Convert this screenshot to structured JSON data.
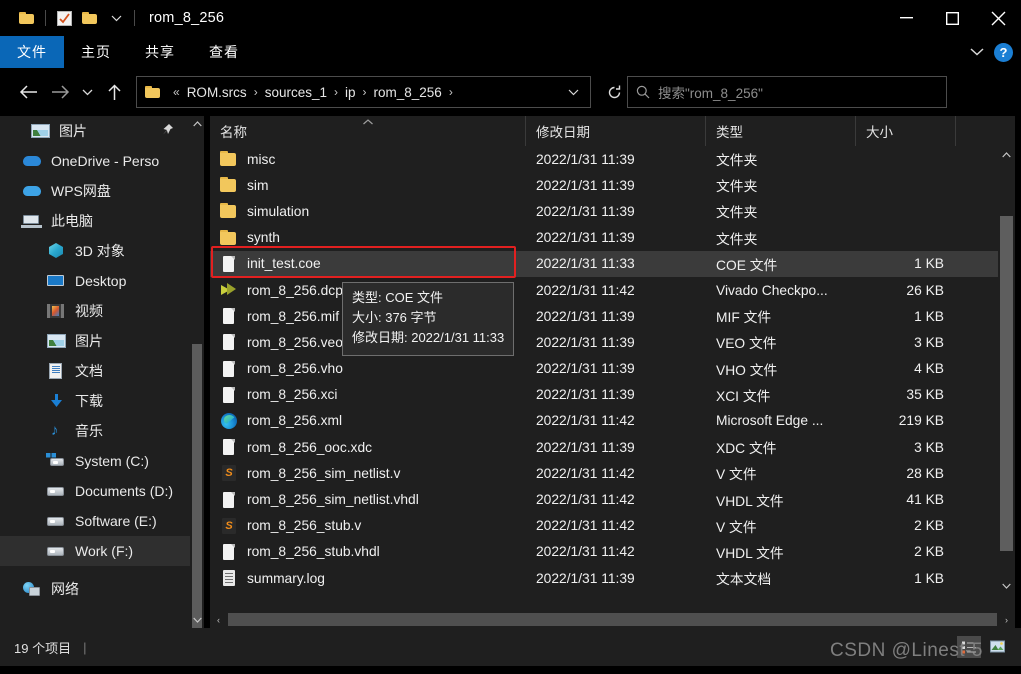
{
  "window": {
    "title": "rom_8_256",
    "quick_access": [
      "folder-icon",
      "checkbox-icon",
      "folder-icon",
      "dropdown-caret"
    ],
    "controls": {
      "minimize": "minimize-icon",
      "maximize": "maximize-icon",
      "close": "close-icon"
    }
  },
  "ribbon": {
    "tabs": [
      {
        "label": "文件",
        "active": true
      },
      {
        "label": "主页",
        "active": false
      },
      {
        "label": "共享",
        "active": false
      },
      {
        "label": "查看",
        "active": false
      }
    ],
    "collapse": "chevron-down-icon",
    "help": "?"
  },
  "address": {
    "back": "back-arrow-icon",
    "forward": "forward-arrow-icon",
    "recent": "chevron-down-icon",
    "up": "up-arrow-icon",
    "prefix": "«",
    "crumbs": [
      "ROM.srcs",
      "sources_1",
      "ip",
      "rom_8_256"
    ],
    "separator": "›",
    "dropdown": "chevron-down-icon",
    "refresh": "refresh-icon"
  },
  "search": {
    "icon": "search-icon",
    "placeholder": "搜索\"rom_8_256\"",
    "value": ""
  },
  "sidebar": {
    "items": [
      {
        "label": "图片",
        "icon": "picture-icon",
        "level": 1,
        "pinned": true,
        "selected": false
      },
      {
        "label": "OneDrive - Perso",
        "icon": "onedrive-icon",
        "level": 0,
        "selected": false
      },
      {
        "label": "WPS网盘",
        "icon": "wps-cloud-icon",
        "level": 0,
        "selected": false
      },
      {
        "label": "此电脑",
        "icon": "this-pc-icon",
        "level": 0,
        "selected": false
      },
      {
        "label": "3D 对象",
        "icon": "3d-objects-icon",
        "level": 1,
        "selected": false
      },
      {
        "label": "Desktop",
        "icon": "desktop-icon",
        "level": 1,
        "selected": false
      },
      {
        "label": "视频",
        "icon": "videos-icon",
        "level": 1,
        "selected": false
      },
      {
        "label": "图片",
        "icon": "picture-icon",
        "level": 1,
        "selected": false
      },
      {
        "label": "文档",
        "icon": "documents-icon",
        "level": 1,
        "selected": false
      },
      {
        "label": "下载",
        "icon": "downloads-icon",
        "level": 1,
        "selected": false
      },
      {
        "label": "音乐",
        "icon": "music-icon",
        "level": 1,
        "selected": false
      },
      {
        "label": "System (C:)",
        "icon": "windows-drive-icon",
        "level": 1,
        "selected": false
      },
      {
        "label": "Documents (D:)",
        "icon": "drive-icon",
        "level": 1,
        "selected": false
      },
      {
        "label": "Software (E:)",
        "icon": "drive-icon",
        "level": 1,
        "selected": false
      },
      {
        "label": "Work (F:)",
        "icon": "drive-icon",
        "level": 1,
        "selected": true
      },
      {
        "label": "网络",
        "icon": "network-icon",
        "level": 0,
        "selected": false
      }
    ],
    "scroll_up": "chevron-up-icon",
    "scroll_down": "chevron-down-icon",
    "pin_icon": "pin-icon"
  },
  "filelist": {
    "columns": [
      {
        "label": "名称",
        "sorted": true,
        "sort_caret": "caret-up"
      },
      {
        "label": "修改日期",
        "sorted": false
      },
      {
        "label": "类型",
        "sorted": false
      },
      {
        "label": "大小",
        "sorted": false
      }
    ],
    "rows": [
      {
        "name": "misc",
        "icon": "folder-icon",
        "date": "2022/1/31 11:39",
        "type": "文件夹",
        "size": "",
        "selected": false
      },
      {
        "name": "sim",
        "icon": "folder-icon",
        "date": "2022/1/31 11:39",
        "type": "文件夹",
        "size": "",
        "selected": false
      },
      {
        "name": "simulation",
        "icon": "folder-icon",
        "date": "2022/1/31 11:39",
        "type": "文件夹",
        "size": "",
        "selected": false
      },
      {
        "name": "synth",
        "icon": "folder-icon",
        "date": "2022/1/31 11:39",
        "type": "文件夹",
        "size": "",
        "selected": false
      },
      {
        "name": "init_test.coe",
        "icon": "document-icon",
        "date": "2022/1/31 11:33",
        "type": "COE 文件",
        "size": "1 KB",
        "selected": true
      },
      {
        "name": "rom_8_256.dcp",
        "icon": "vivado-icon",
        "date": "2022/1/31 11:42",
        "type": "Vivado Checkpo...",
        "size": "26 KB",
        "selected": false
      },
      {
        "name": "rom_8_256.mif",
        "icon": "document-icon",
        "date": "2022/1/31 11:39",
        "type": "MIF 文件",
        "size": "1 KB",
        "selected": false
      },
      {
        "name": "rom_8_256.veo",
        "icon": "document-icon",
        "date": "2022/1/31 11:39",
        "type": "VEO 文件",
        "size": "3 KB",
        "selected": false
      },
      {
        "name": "rom_8_256.vho",
        "icon": "document-icon",
        "date": "2022/1/31 11:39",
        "type": "VHO 文件",
        "size": "4 KB",
        "selected": false
      },
      {
        "name": "rom_8_256.xci",
        "icon": "document-icon",
        "date": "2022/1/31 11:39",
        "type": "XCI 文件",
        "size": "35 KB",
        "selected": false
      },
      {
        "name": "rom_8_256.xml",
        "icon": "edge-icon",
        "date": "2022/1/31 11:42",
        "type": "Microsoft Edge ...",
        "size": "219 KB",
        "selected": false
      },
      {
        "name": "rom_8_256_ooc.xdc",
        "icon": "document-icon",
        "date": "2022/1/31 11:39",
        "type": "XDC 文件",
        "size": "3 KB",
        "selected": false
      },
      {
        "name": "rom_8_256_sim_netlist.v",
        "icon": "sublime-icon",
        "date": "2022/1/31 11:42",
        "type": "V 文件",
        "size": "28 KB",
        "selected": false
      },
      {
        "name": "rom_8_256_sim_netlist.vhdl",
        "icon": "document-icon",
        "date": "2022/1/31 11:42",
        "type": "VHDL 文件",
        "size": "41 KB",
        "selected": false
      },
      {
        "name": "rom_8_256_stub.v",
        "icon": "sublime-icon",
        "date": "2022/1/31 11:42",
        "type": "V 文件",
        "size": "2 KB",
        "selected": false
      },
      {
        "name": "rom_8_256_stub.vhdl",
        "icon": "document-icon",
        "date": "2022/1/31 11:42",
        "type": "VHDL 文件",
        "size": "2 KB",
        "selected": false
      },
      {
        "name": "summary.log",
        "icon": "log-icon",
        "date": "2022/1/31 11:39",
        "type": "文本文档",
        "size": "1 KB",
        "selected": false
      }
    ]
  },
  "tooltip": {
    "line1": "类型: COE 文件",
    "line2": "大小: 376 字节",
    "line3": "修改日期: 2022/1/31 11:33"
  },
  "statusbar": {
    "count": "19 个项目",
    "views": [
      "details-view-icon",
      "large-icons-view-icon"
    ]
  },
  "watermark": {
    "text": "CSDN @Linest-5"
  },
  "colors": {
    "accent": "#0a67b7",
    "highlight_box": "#e22020",
    "selection": "#3b3b3b",
    "pane_bg": "#1f1f1f",
    "window_bg": "#000000"
  }
}
